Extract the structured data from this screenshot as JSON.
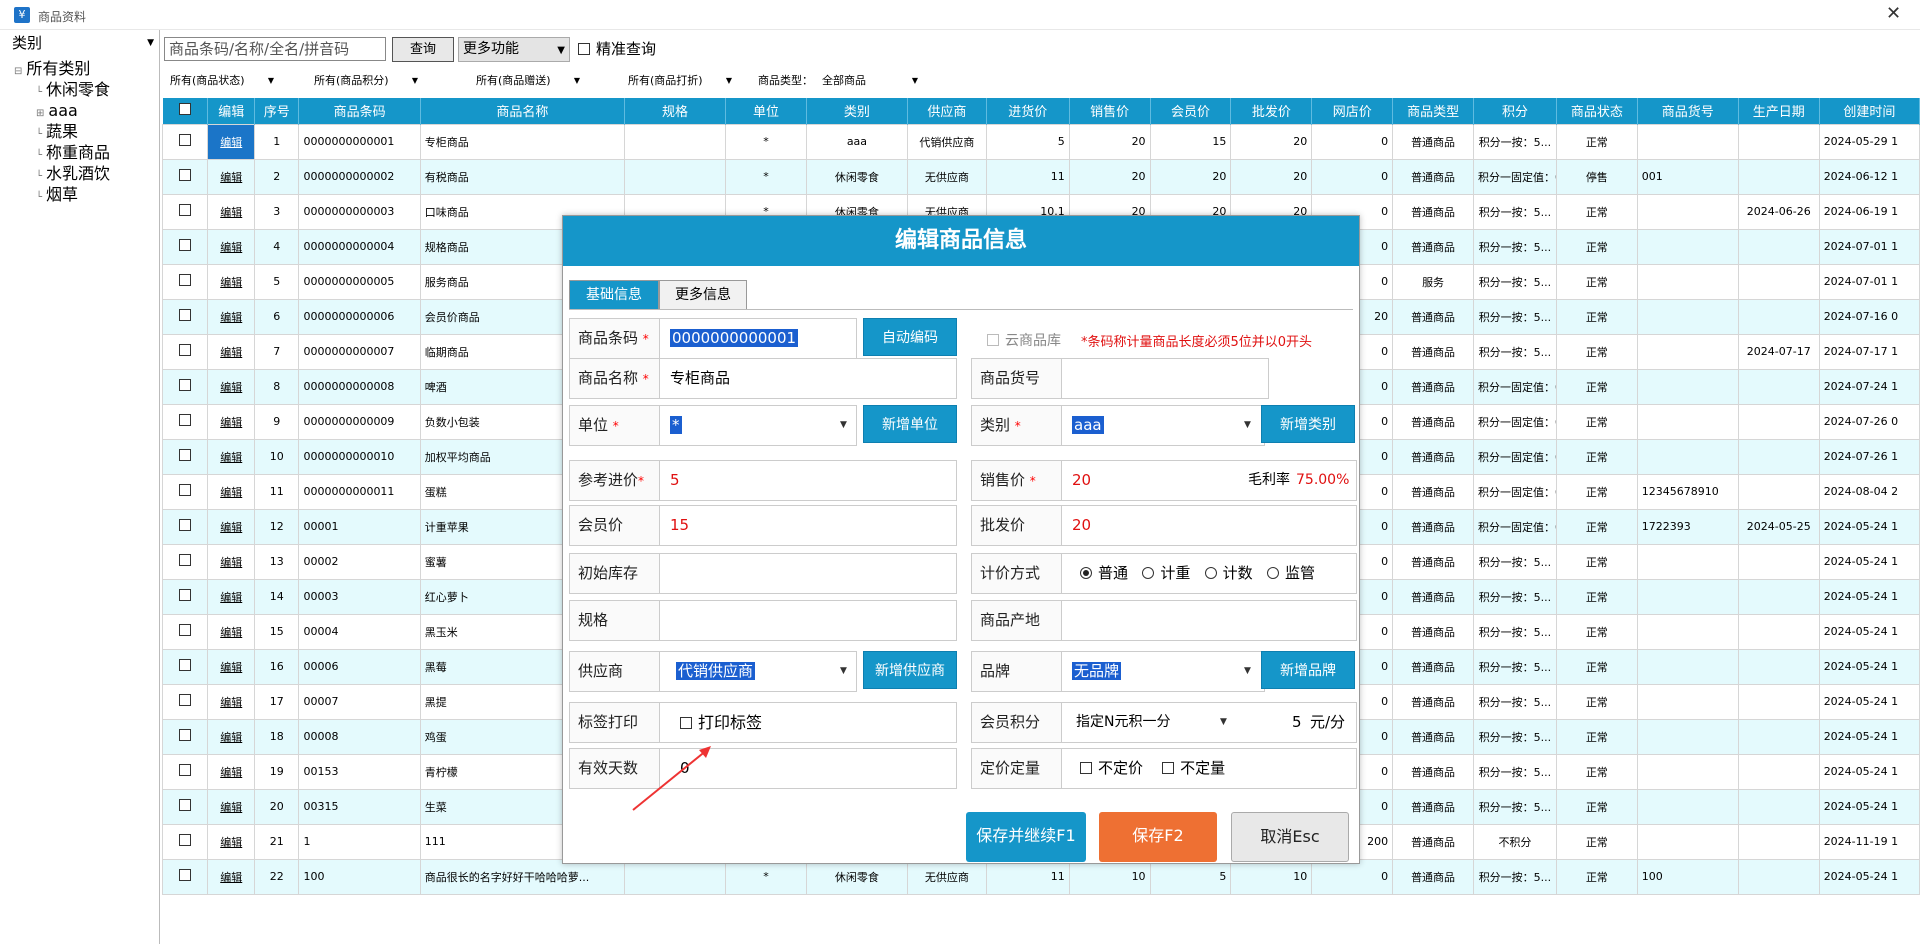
{
  "window": {
    "title": "商品资料",
    "icon": "yen-icon",
    "close": "✕"
  },
  "sidebar": {
    "category_label": "类别",
    "tree": [
      {
        "label": "所有类别",
        "prefix": "⊟"
      },
      {
        "label": "休闲零食",
        "prefix": "└"
      },
      {
        "label": "aaa",
        "prefix": "⊞"
      },
      {
        "label": "蔬果",
        "prefix": "└"
      },
      {
        "label": "称重商品",
        "prefix": "└"
      },
      {
        "label": "水乳酒饮",
        "prefix": "└"
      },
      {
        "label": "烟草",
        "prefix": "└"
      }
    ]
  },
  "toolbar": {
    "search_placeholder": "商品条码/名称/全名/拼音码",
    "query_label": "查询",
    "more_label": "更多功能",
    "exact_label": "精准查询"
  },
  "filters": [
    "所有(商品状态)",
    "所有(商品积分)",
    "所有(商品赠送)",
    "所有(商品打折)",
    "商品类型：",
    "全部商品"
  ],
  "table": {
    "headers": [
      "",
      "编辑",
      "序号",
      "商品条码",
      "商品名称",
      "规格",
      "单位",
      "类别",
      "供应商",
      "进货价",
      "销售价",
      "会员价",
      "批发价",
      "网店价",
      "商品类型",
      "积分",
      "商品状态",
      "商品货号",
      "生产日期",
      "创建时间"
    ],
    "rows": [
      [
        "编辑",
        "1",
        "0000000000001",
        "专柜商品",
        "",
        "*",
        "aaa",
        "代销供应商",
        "5",
        "20",
        "15",
        "20",
        "0",
        "普通商品",
        "积分一按：5...",
        "正常",
        "",
        "",
        "2024-05-29 1"
      ],
      [
        "编辑",
        "2",
        "0000000000002",
        "有税商品",
        "",
        "*",
        "休闲零食",
        "无供应商",
        "11",
        "20",
        "20",
        "20",
        "0",
        "普通商品",
        "积分一固定值：0",
        "停售",
        "001",
        "",
        "2024-06-12 1"
      ],
      [
        "编辑",
        "3",
        "0000000000003",
        "口味商品",
        "",
        "*",
        "休闲零食",
        "无供应商",
        "10.1",
        "20",
        "20",
        "20",
        "0",
        "普通商品",
        "积分一按：5...",
        "正常",
        "",
        "2024-06-26",
        "2024-06-19 1"
      ],
      [
        "编辑",
        "4",
        "0000000000004",
        "规格商品",
        "",
        "",
        "",
        "",
        "",
        "",
        "",
        "",
        "0",
        "普通商品",
        "积分一按：5...",
        "正常",
        "",
        "",
        "2024-07-01 1"
      ],
      [
        "编辑",
        "5",
        "0000000000005",
        "服务商品",
        "",
        "",
        "",
        "",
        "",
        "",
        "",
        "",
        "0",
        "服务",
        "积分一按：5...",
        "正常",
        "",
        "",
        "2024-07-01 1"
      ],
      [
        "编辑",
        "6",
        "0000000000006",
        "会员价商品",
        "",
        "",
        "",
        "",
        "",
        "",
        "",
        "",
        "20",
        "普通商品",
        "积分一按：5...",
        "正常",
        "",
        "",
        "2024-07-16 0"
      ],
      [
        "编辑",
        "7",
        "0000000000007",
        "临期商品",
        "",
        "",
        "",
        "",
        "",
        "",
        "",
        "",
        "0",
        "普通商品",
        "积分一按：5...",
        "正常",
        "",
        "2024-07-17",
        "2024-07-17 1"
      ],
      [
        "编辑",
        "8",
        "0000000000008",
        "啤酒",
        "",
        "",
        "",
        "",
        "",
        "",
        "",
        "",
        "0",
        "普通商品",
        "积分一固定值：0",
        "正常",
        "",
        "",
        "2024-07-24 1"
      ],
      [
        "编辑",
        "9",
        "0000000000009",
        "负数小包装",
        "",
        "",
        "",
        "",
        "",
        "",
        "",
        "",
        "0",
        "普通商品",
        "积分一固定值：0",
        "正常",
        "",
        "",
        "2024-07-26 0"
      ],
      [
        "编辑",
        "10",
        "0000000000010",
        "加权平均商品",
        "",
        "",
        "",
        "",
        "",
        "",
        "",
        "",
        "0",
        "普通商品",
        "积分一固定值：0",
        "正常",
        "",
        "",
        "2024-07-26 1"
      ],
      [
        "编辑",
        "11",
        "0000000000011",
        "蛋糕",
        "",
        "",
        "",
        "",
        "",
        "",
        "",
        "",
        "0",
        "普通商品",
        "积分一固定值：0",
        "正常",
        "12345678910",
        "",
        "2024-08-04 2"
      ],
      [
        "编辑",
        "12",
        "00001",
        "计重苹果",
        "",
        "",
        "",
        "",
        "",
        "",
        "",
        "",
        "0",
        "普通商品",
        "积分一固定值：0",
        "正常",
        "1722393",
        "2024-05-25",
        "2024-05-24 1"
      ],
      [
        "编辑",
        "13",
        "00002",
        "蜜薯",
        "",
        "",
        "",
        "",
        "",
        "",
        "",
        "",
        "0",
        "普通商品",
        "积分一按：5...",
        "正常",
        "",
        "",
        "2024-05-24 1"
      ],
      [
        "编辑",
        "14",
        "00003",
        "红心萝卜",
        "",
        "",
        "",
        "",
        "",
        "",
        "",
        "",
        "0",
        "普通商品",
        "积分一按：5...",
        "正常",
        "",
        "",
        "2024-05-24 1"
      ],
      [
        "编辑",
        "15",
        "00004",
        "黑玉米",
        "",
        "",
        "",
        "",
        "",
        "",
        "",
        "",
        "0",
        "普通商品",
        "积分一按：5...",
        "正常",
        "",
        "",
        "2024-05-24 1"
      ],
      [
        "编辑",
        "16",
        "00006",
        "黑莓",
        "",
        "",
        "",
        "",
        "",
        "",
        "",
        "",
        "0",
        "普通商品",
        "积分一按：5...",
        "正常",
        "",
        "",
        "2024-05-24 1"
      ],
      [
        "编辑",
        "17",
        "00007",
        "黑提",
        "",
        "",
        "",
        "",
        "",
        "",
        "",
        "",
        "0",
        "普通商品",
        "积分一按：5...",
        "正常",
        "",
        "",
        "2024-05-24 1"
      ],
      [
        "编辑",
        "18",
        "00008",
        "鸡蛋",
        "",
        "",
        "",
        "",
        "",
        "",
        "",
        "",
        "0",
        "普通商品",
        "积分一按：5...",
        "正常",
        "",
        "",
        "2024-05-24 1"
      ],
      [
        "编辑",
        "19",
        "00153",
        "青柠檬",
        "",
        "",
        "",
        "",
        "",
        "",
        "",
        "",
        "0",
        "普通商品",
        "积分一按：5...",
        "正常",
        "",
        "",
        "2024-05-24 1"
      ],
      [
        "编辑",
        "20",
        "00315",
        "生菜",
        "",
        "",
        "",
        "",
        "",
        "",
        "",
        "",
        "0",
        "普通商品",
        "积分一按：5...",
        "正常",
        "",
        "",
        "2024-05-24 1"
      ],
      [
        "编辑",
        "21",
        "1",
        "111",
        "",
        "",
        "",
        "",
        "",
        "",
        "",
        "",
        "200",
        "普通商品",
        "不积分",
        "正常",
        "",
        "",
        "2024-11-19 1"
      ],
      [
        "编辑",
        "22",
        "100",
        "商品很长的名字好好干哈哈哈萝...",
        "",
        "*",
        "休闲零食",
        "无供应商",
        "11",
        "10",
        "5",
        "10",
        "0",
        "普通商品",
        "积分一按：5...",
        "正常",
        "100",
        "",
        "2024-05-24 1"
      ]
    ]
  },
  "dialog": {
    "title": "编辑商品信息",
    "tabs": [
      "基础信息",
      "更多信息"
    ],
    "barcode_label": "商品条码",
    "barcode_value": "0000000000001",
    "auto_code": "自动编码",
    "cloud_label": "云商品库",
    "cloud_note": "*条码称计量商品长度必须5位并以0开头",
    "name_label": "商品名称",
    "name_value": "专柜商品",
    "itemno_label": "商品货号",
    "itemno_value": "",
    "unit_label": "单位",
    "unit_value": "*",
    "add_unit": "新增单位",
    "cat_label": "类别",
    "cat_value": "aaa",
    "add_cat": "新增类别",
    "cost_label": "参考进价",
    "cost_value": "5",
    "price_label": "销售价",
    "price_value": "20",
    "margin_label": "毛利率",
    "margin_value": "75.00%",
    "member_label": "会员价",
    "member_value": "15",
    "wholesale_label": "批发价",
    "wholesale_value": "20",
    "stock_label": "初始库存",
    "stock_value": "",
    "pricing_label": "计价方式",
    "pricing_options": [
      "普通",
      "计重",
      "计数",
      "监管"
    ],
    "spec_label": "规格",
    "spec_value": "",
    "origin_label": "商品产地",
    "origin_value": "",
    "supplier_label": "供应商",
    "supplier_value": "代销供应商",
    "add_supplier": "新增供应商",
    "brand_label": "品牌",
    "brand_value": "无品牌",
    "add_brand": "新增品牌",
    "tag_label": "标签打印",
    "tag_option": "打印标签",
    "points_label": "会员积分",
    "points_mode": "指定N元积一分",
    "points_value": "5",
    "points_unit": "元/分",
    "days_label": "有效天数",
    "days_value": "0",
    "fixed_label": "定价定量",
    "fixed_options": [
      "不定价",
      "不定量"
    ],
    "btn_save_continue": "保存并继续F1",
    "btn_save": "保存F2",
    "btn_cancel": "取消Esc",
    "req_mark": "*"
  },
  "colors": {
    "accent": "#1596c9",
    "alt_row": "#e4fafd",
    "required": "#e01010",
    "save": "#ee7033"
  }
}
